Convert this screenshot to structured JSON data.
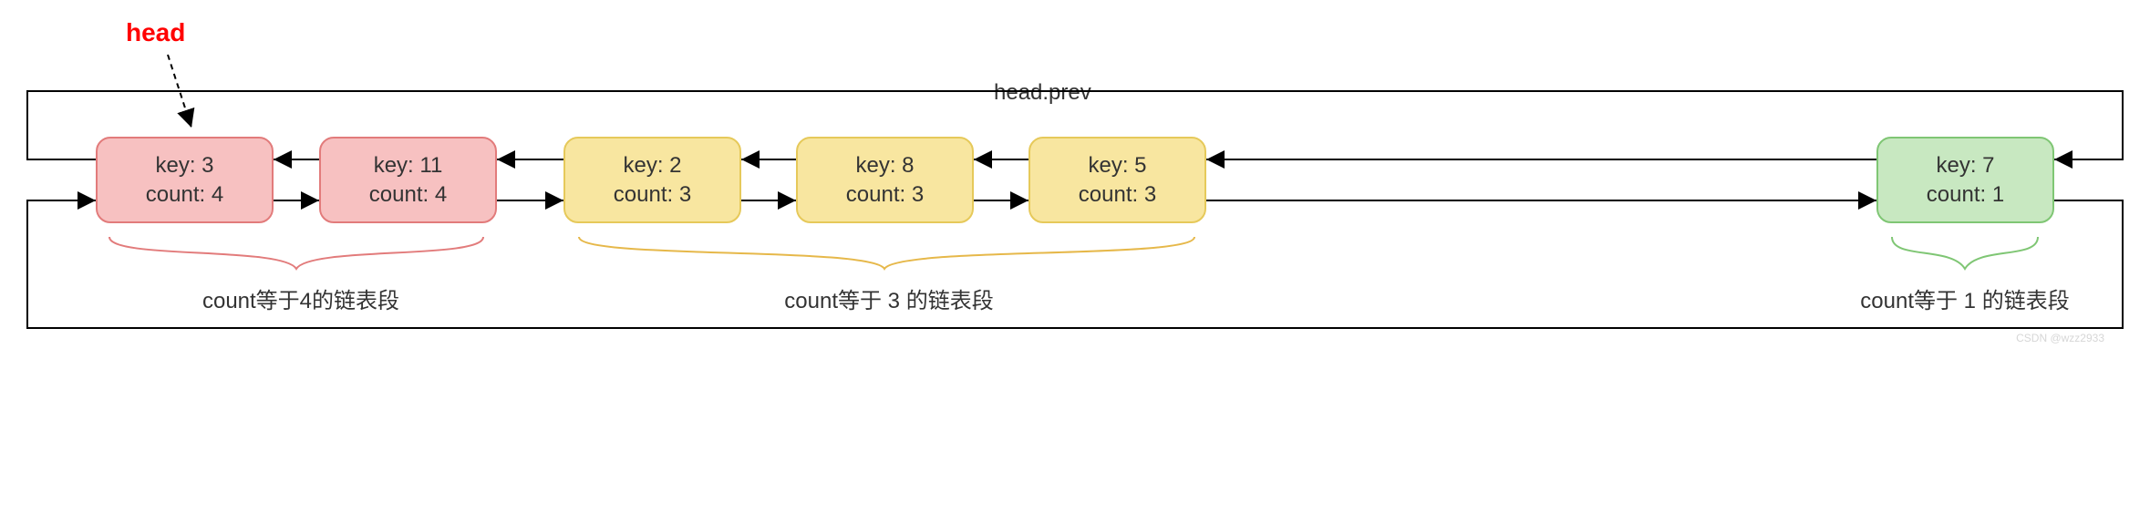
{
  "head_label": "head",
  "top_link_label": "head.prev",
  "nodes": [
    {
      "key_label": "key: 3",
      "count_label": "count: 4",
      "color": "red"
    },
    {
      "key_label": "key: 11",
      "count_label": "count: 4",
      "color": "red"
    },
    {
      "key_label": "key: 2",
      "count_label": "count: 3",
      "color": "yellow"
    },
    {
      "key_label": "key: 8",
      "count_label": "count: 3",
      "color": "yellow"
    },
    {
      "key_label": "key: 5",
      "count_label": "count: 3",
      "color": "yellow"
    },
    {
      "key_label": "key: 7",
      "count_label": "count: 1",
      "color": "green"
    }
  ],
  "segments": [
    {
      "label": "count等于4的链表段",
      "color": "#e27b7b"
    },
    {
      "label": "count等于 3 的链表段",
      "color": "#e6b84a"
    },
    {
      "label": "count等于 1 的链表段",
      "color": "#7fc674"
    }
  ],
  "watermark": "CSDN @wzz2933",
  "chart_data": {
    "type": "table",
    "title": "doubly linked list with count segments",
    "columns": [
      "key",
      "count"
    ],
    "rows": [
      [
        3,
        4
      ],
      [
        11,
        4
      ],
      [
        2,
        3
      ],
      [
        8,
        3
      ],
      [
        5,
        3
      ],
      [
        7,
        1
      ]
    ],
    "segments": [
      {
        "count": 4,
        "keys": [
          3,
          11
        ]
      },
      {
        "count": 3,
        "keys": [
          2,
          8,
          5
        ]
      },
      {
        "count": 1,
        "keys": [
          7
        ]
      }
    ],
    "head_key": 3,
    "head_prev_label": "head.prev",
    "circular": true
  }
}
